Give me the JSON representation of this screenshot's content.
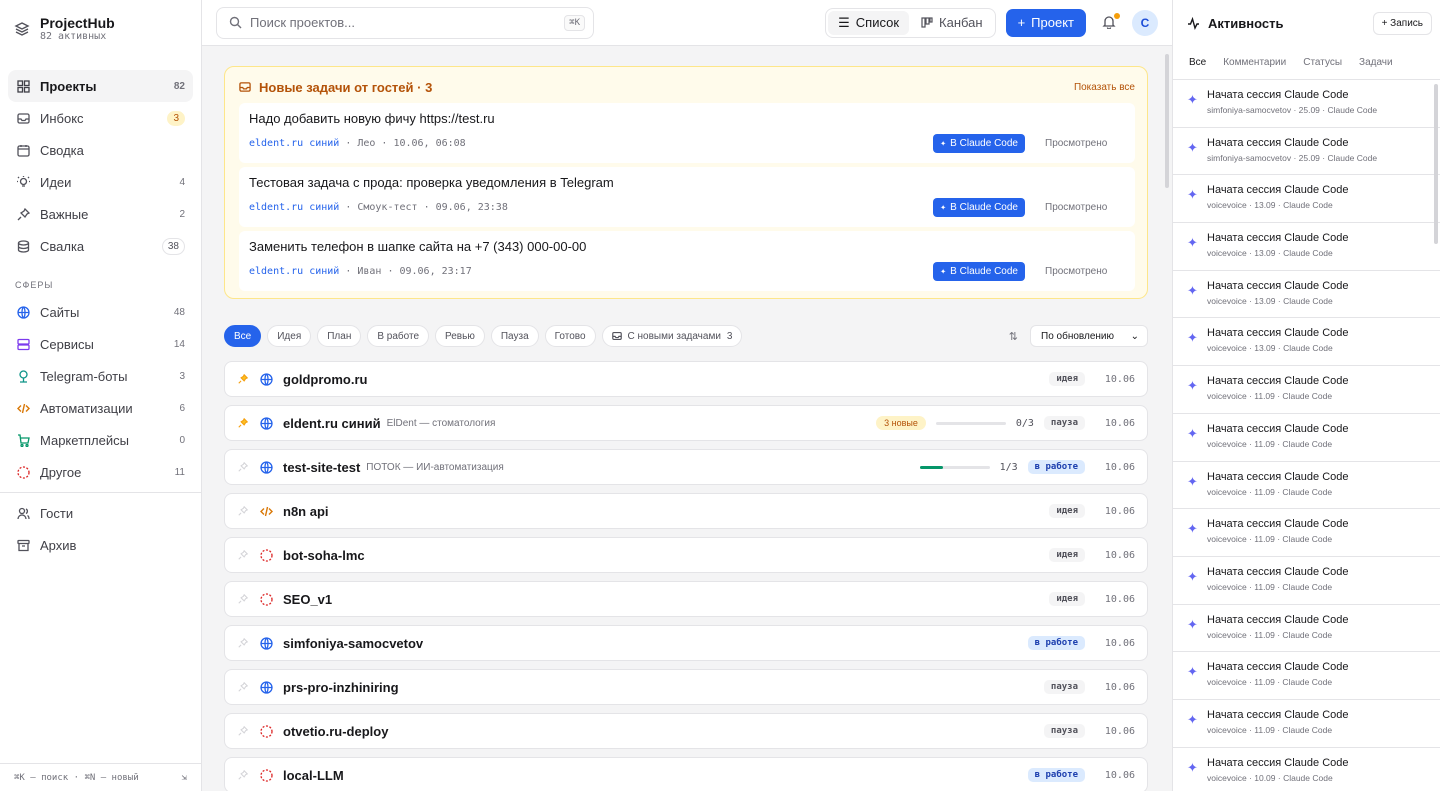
{
  "app": {
    "title": "ProjectHub",
    "subtitle": "82 активных"
  },
  "sidebar": {
    "items": [
      {
        "label": "Проекты",
        "count": "82",
        "icon": "grid-icon",
        "active": true
      },
      {
        "label": "Инбокс",
        "count": "3",
        "icon": "inbox-icon"
      },
      {
        "label": "Сводка",
        "count": "",
        "icon": "calendar-icon"
      },
      {
        "label": "Идеи",
        "count": "4",
        "icon": "lightbulb-icon"
      },
      {
        "label": "Важные",
        "count": "2",
        "icon": "pin-icon"
      },
      {
        "label": "Свалка",
        "count": "38",
        "icon": "database-icon"
      }
    ],
    "spheres_title": "СФЕРЫ",
    "spheres": [
      {
        "label": "Сайты",
        "count": "48",
        "icon": "globe-icon",
        "color": "#2563eb"
      },
      {
        "label": "Сервисы",
        "count": "14",
        "icon": "server-icon",
        "color": "#7c3aed"
      },
      {
        "label": "Telegram-боты",
        "count": "3",
        "icon": "bot-icon",
        "color": "#0d9488"
      },
      {
        "label": "Автоматизации",
        "count": "6",
        "icon": "code-icon",
        "color": "#d97706"
      },
      {
        "label": "Маркетплейсы",
        "count": "0",
        "icon": "cart-icon",
        "color": "#059669"
      },
      {
        "label": "Другое",
        "count": "11",
        "icon": "dashed-circle-icon",
        "color": "#dc2626"
      }
    ],
    "bottom": [
      {
        "label": "Гости",
        "icon": "users-icon"
      },
      {
        "label": "Архив",
        "icon": "archive-icon"
      }
    ],
    "footer": "⌘K — поиск · ⌘N — новый"
  },
  "topbar": {
    "search_placeholder": "Поиск проектов...",
    "search_kbd": "⌘K",
    "view_list": "Список",
    "view_kanban": "Канбан",
    "new_project": "Проект",
    "avatar": "С"
  },
  "guest": {
    "title": "Новые задачи от гостей · 3",
    "show_all": "Показать все",
    "items": [
      {
        "text": "Надо добавить новую фичу https://test.ru",
        "source": "eldent.ru синий",
        "author": "Лео",
        "date": "10.06, 06:08",
        "action": "В Claude Code",
        "seen": "Просмотрено"
      },
      {
        "text": "Тестовая задача с прода: проверка уведомления в Telegram",
        "source": "eldent.ru синий",
        "author": "Смоук-тест",
        "date": "09.06, 23:38",
        "action": "В Claude Code",
        "seen": "Просмотрено"
      },
      {
        "text": "Заменить телефон в шапке сайта на +7 (343) 000-00-00",
        "source": "eldent.ru синий",
        "author": "Иван",
        "date": "09.06, 23:17",
        "action": "В Claude Code",
        "seen": "Просмотрено"
      }
    ]
  },
  "filters": {
    "chips": [
      "Все",
      "Идея",
      "План",
      "В работе",
      "Ревью",
      "Пауза",
      "Готово"
    ],
    "new_tasks": "С новыми задачами",
    "new_tasks_count": "3",
    "sort": "По обновлению"
  },
  "projects": [
    {
      "name": "goldpromo.ru",
      "sub": "",
      "icon": "globe-icon",
      "pinned": true,
      "status": "идея",
      "status_kind": "idea",
      "date": "10.06"
    },
    {
      "name": "eldent.ru синий",
      "sub": "ElDent — стоматология",
      "icon": "globe-icon",
      "pinned": true,
      "new_badge": "3 новые",
      "progress": 0,
      "progress_text": "0/3",
      "status": "пауза",
      "status_kind": "pause",
      "date": "10.06"
    },
    {
      "name": "test-site-test",
      "sub": "ПОТОК — ИИ-автоматизация",
      "icon": "globe-icon",
      "pinned": false,
      "progress": 0.33,
      "progress_text": "1/3",
      "status": "в работе",
      "status_kind": "work",
      "date": "10.06"
    },
    {
      "name": "n8n api",
      "sub": "",
      "icon": "code-icon",
      "pinned": false,
      "status": "идея",
      "status_kind": "idea",
      "date": "10.06"
    },
    {
      "name": "bot-soha-lmc",
      "sub": "",
      "icon": "dashed-circle-icon",
      "pinned": false,
      "status": "идея",
      "status_kind": "idea",
      "date": "10.06"
    },
    {
      "name": "SEO_v1",
      "sub": "",
      "icon": "dashed-circle-icon",
      "pinned": false,
      "status": "идея",
      "status_kind": "idea",
      "date": "10.06"
    },
    {
      "name": "simfoniya-samocvetov",
      "sub": "",
      "icon": "globe-icon",
      "pinned": false,
      "status": "в работе",
      "status_kind": "work",
      "date": "10.06"
    },
    {
      "name": "prs-pro-inzhiniring",
      "sub": "",
      "icon": "globe-icon",
      "pinned": false,
      "status": "пауза",
      "status_kind": "pause",
      "date": "10.06"
    },
    {
      "name": "otvetio.ru-deploy",
      "sub": "",
      "icon": "dashed-circle-icon",
      "pinned": false,
      "status": "пауза",
      "status_kind": "pause",
      "date": "10.06"
    },
    {
      "name": "local-LLM",
      "sub": "",
      "icon": "dashed-circle-icon",
      "pinned": false,
      "status": "в работе",
      "status_kind": "work",
      "date": "10.06"
    }
  ],
  "activity": {
    "title": "Активность",
    "add": "+ Запись",
    "tabs": [
      "Все",
      "Комментарии",
      "Статусы",
      "Задачи"
    ],
    "items": [
      {
        "title": "Начата сессия Claude Code",
        "meta": "simfoniya-samocvetov · 25.09 · Claude Code"
      },
      {
        "title": "Начата сессия Claude Code",
        "meta": "simfoniya-samocvetov · 25.09 · Claude Code"
      },
      {
        "title": "Начата сессия Claude Code",
        "meta": "voicevoice · 13.09 · Claude Code"
      },
      {
        "title": "Начата сессия Claude Code",
        "meta": "voicevoice · 13.09 · Claude Code"
      },
      {
        "title": "Начата сессия Claude Code",
        "meta": "voicevoice · 13.09 · Claude Code"
      },
      {
        "title": "Начата сессия Claude Code",
        "meta": "voicevoice · 13.09 · Claude Code"
      },
      {
        "title": "Начата сессия Claude Code",
        "meta": "voicevoice · 11.09 · Claude Code"
      },
      {
        "title": "Начата сессия Claude Code",
        "meta": "voicevoice · 11.09 · Claude Code"
      },
      {
        "title": "Начата сессия Claude Code",
        "meta": "voicevoice · 11.09 · Claude Code"
      },
      {
        "title": "Начата сессия Claude Code",
        "meta": "voicevoice · 11.09 · Claude Code"
      },
      {
        "title": "Начата сессия Claude Code",
        "meta": "voicevoice · 11.09 · Claude Code"
      },
      {
        "title": "Начата сессия Claude Code",
        "meta": "voicevoice · 11.09 · Claude Code"
      },
      {
        "title": "Начата сессия Claude Code",
        "meta": "voicevoice · 11.09 · Claude Code"
      },
      {
        "title": "Начата сессия Claude Code",
        "meta": "voicevoice · 11.09 · Claude Code"
      },
      {
        "title": "Начата сессия Claude Code",
        "meta": "voicevoice · 10.09 · Claude Code"
      }
    ]
  }
}
